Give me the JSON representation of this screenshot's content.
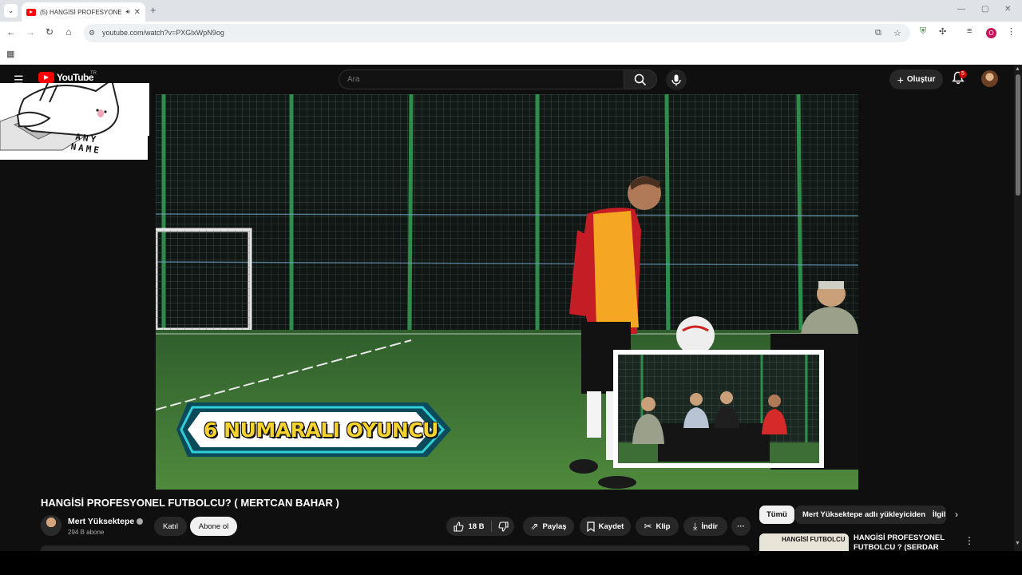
{
  "browser": {
    "tab_title": "(5) HANGİSİ PROFESYONEL",
    "url": "youtube.com/watch?v=PXGlxWpN9og",
    "profile_initial": "O",
    "new_tab": "+",
    "minimize": "—",
    "maximize": "▢",
    "close": "✕"
  },
  "youtube": {
    "logo_text": "YouTube",
    "country": "TR",
    "search_placeholder": "Ara",
    "create_label": "Oluştur",
    "notification_count": "5"
  },
  "video": {
    "banner_text": "6 NUMARALI OYUNCU",
    "title": "HANGİSİ PROFESYONEL FUTBOLCU? ( MERTCAN BAHAR )",
    "channel_name": "Mert Yüksektepe",
    "subscribers": "294 B abone",
    "join_label": "Katıl",
    "subscribe_label": "Abone ol",
    "like_count": "18 B",
    "share_label": "Paylaş",
    "save_label": "Kaydet",
    "clip_label": "Klip",
    "download_label": "İndir",
    "more_label": "···"
  },
  "sidebar": {
    "chips": [
      "Tümü",
      "Mert Yüksektepe adlı yükleyiciden",
      "İlgili"
    ],
    "recommendation": {
      "title": "HANGİSİ PROFESYONEL FUTBOLCU ? (SERDAR",
      "thumb_text": "HANGİSİ FUTBOLCU"
    }
  },
  "sticker": {
    "text": "ANY NAME"
  },
  "colors": {
    "background": "#0f0f0f",
    "brand_red": "#ff0000",
    "banner_yellow": "#f6d32d",
    "banner_cyan": "#2fd0d8",
    "pitch_green": "#3e7a36"
  }
}
